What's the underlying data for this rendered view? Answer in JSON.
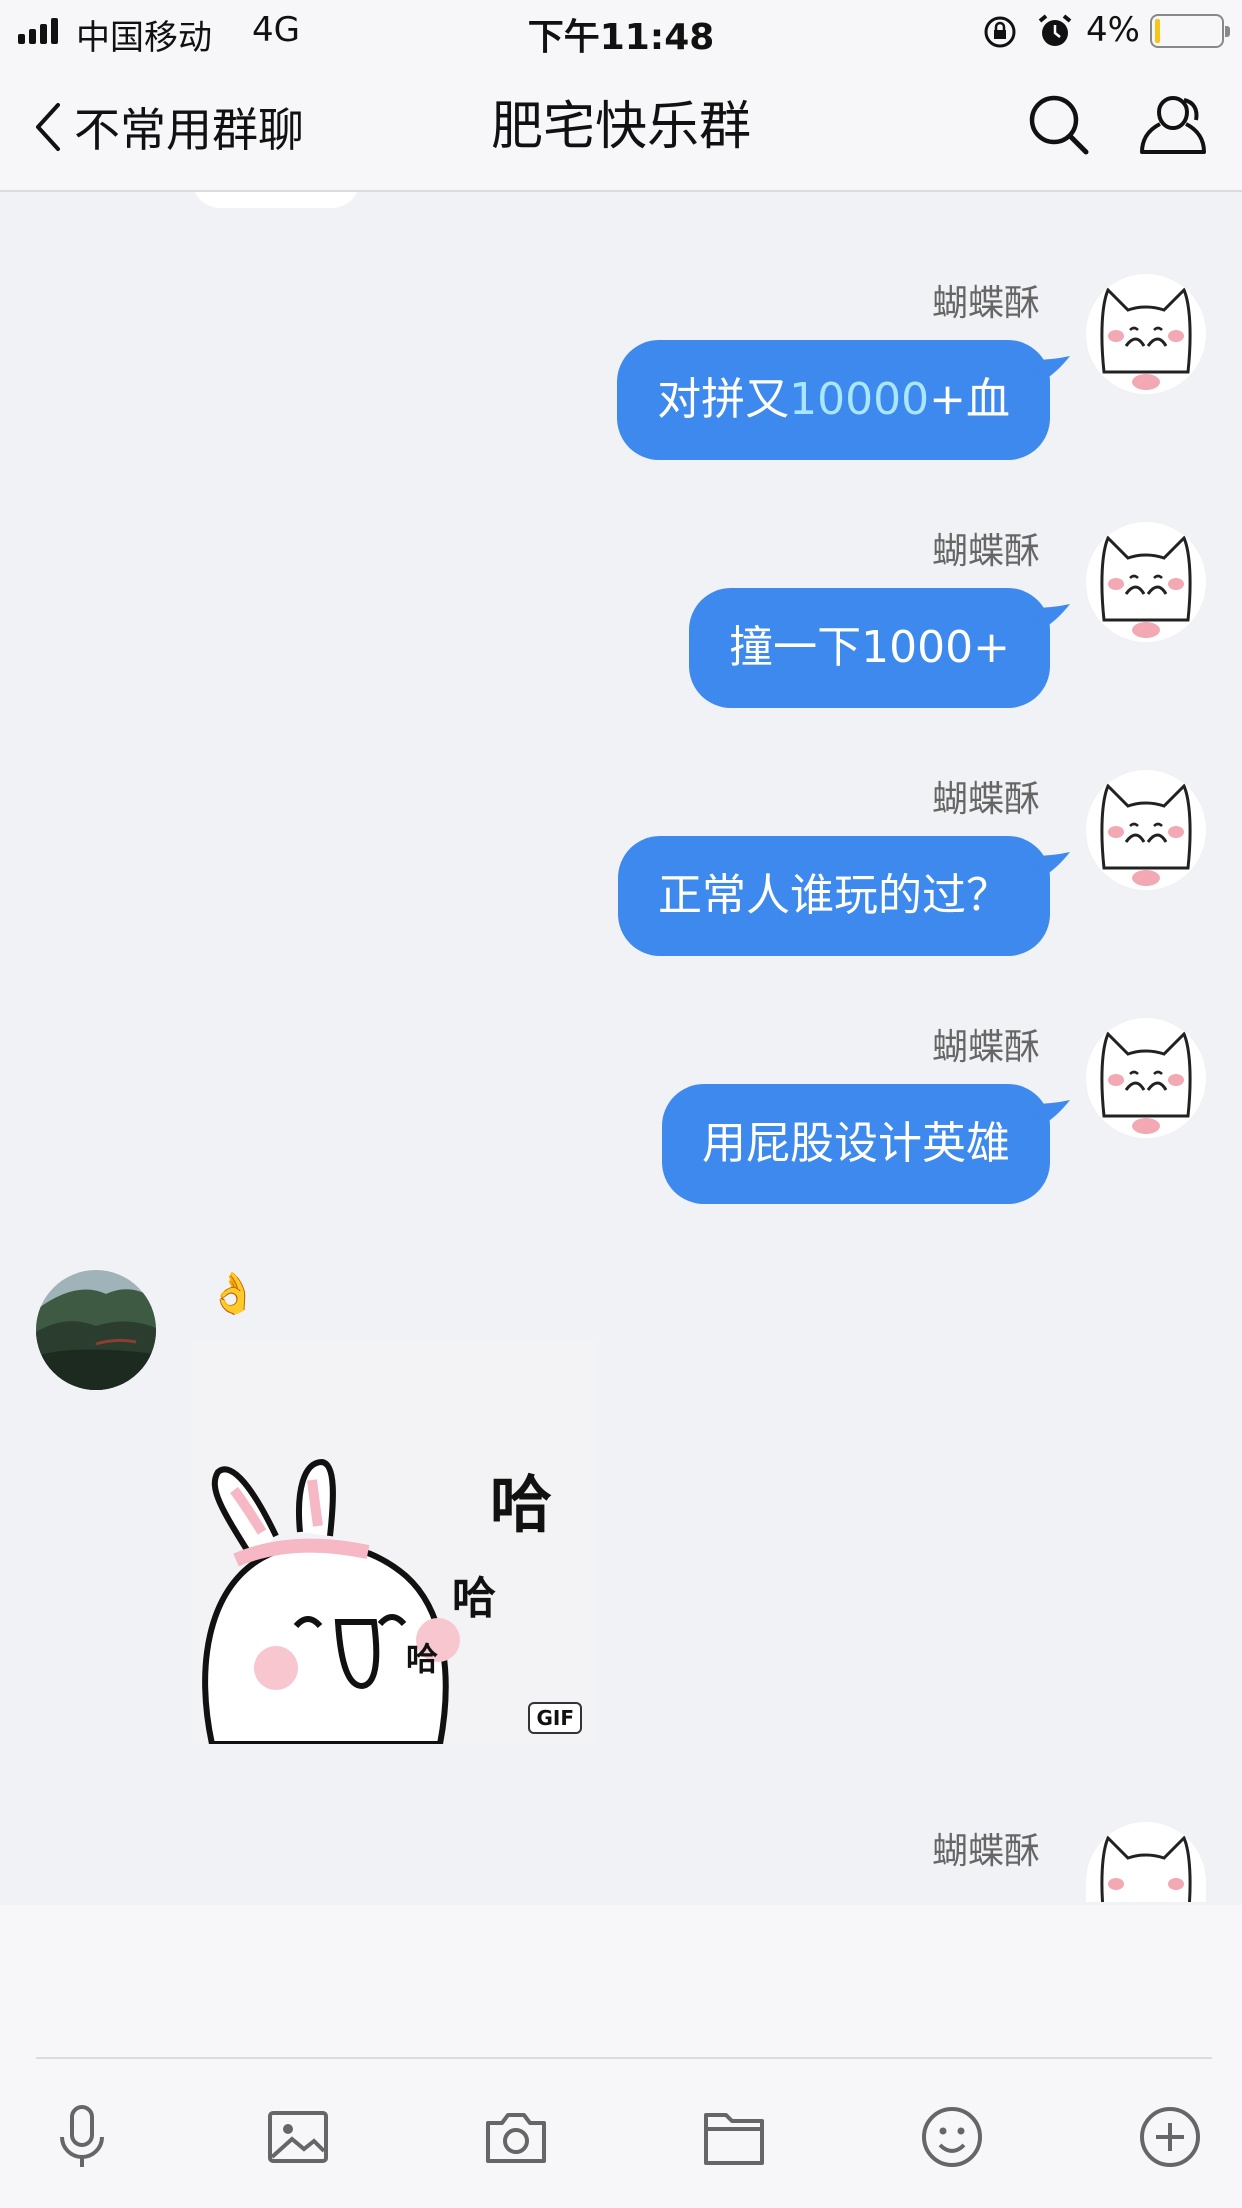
{
  "status_bar": {
    "carrier": "中国移动",
    "network": "4G",
    "time": "下午11:48",
    "battery_percent": "4%",
    "battery_level": 0.04,
    "icons": [
      "signal-icon",
      "orientation-lock-icon",
      "alarm-icon",
      "battery-icon"
    ]
  },
  "nav": {
    "back_label": "不常用群聊",
    "title": "肥宅快乐群",
    "icons": [
      "back-chevron-icon",
      "search-icon",
      "group-members-icon"
    ]
  },
  "messages": [
    {
      "sender": "蝴蝶酥",
      "text_before": "对拼又",
      "text_highlight": "10000",
      "text_after": "+血"
    },
    {
      "sender": "蝴蝶酥",
      "text": "撞一下1000+"
    },
    {
      "sender": "蝴蝶酥",
      "text": "正常人谁玩的过？"
    },
    {
      "sender": "蝴蝶酥",
      "text": "用屁股设计英雄"
    }
  ],
  "incoming": {
    "emoji": "👌",
    "sticker_text": [
      "哈",
      "哈",
      "哈"
    ],
    "gif_label": "GIF"
  },
  "last_message": {
    "sender": "蝴蝶酥"
  },
  "toolbar": {
    "icons": [
      "microphone-icon",
      "image-icon",
      "camera-icon",
      "folder-icon",
      "emoji-icon",
      "plus-icon"
    ]
  },
  "colors": {
    "bubble_out": "#3d89ee",
    "highlight_text": "#a9e6ff",
    "background": "#f1f2f5"
  }
}
